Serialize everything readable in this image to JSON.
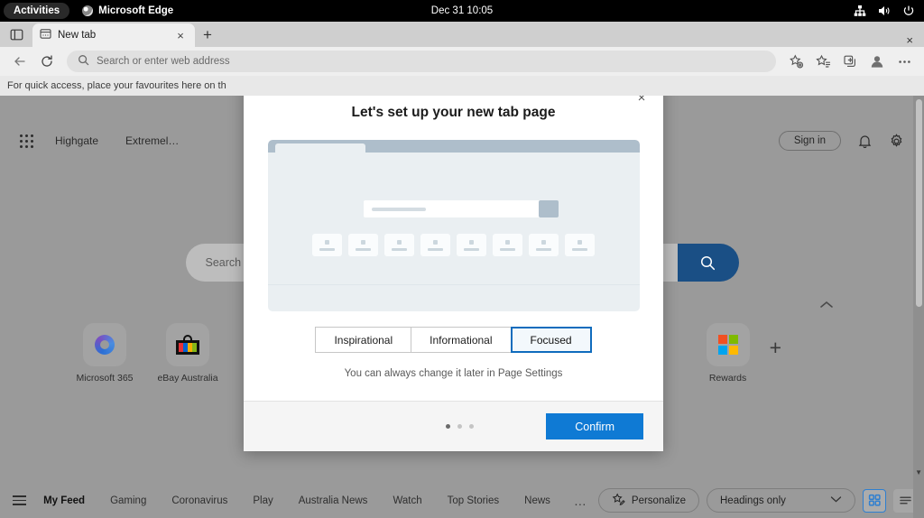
{
  "os_bar": {
    "activities": "Activities",
    "app_name": "Microsoft Edge",
    "clock": "Dec 31  10:05",
    "tray": [
      "network-icon",
      "volume-icon",
      "power-icon"
    ]
  },
  "browser": {
    "tab_title": "New tab",
    "tab_close": "×",
    "new_tab": "+",
    "window_close": "×",
    "sidebar_icon": "sidebar-toggle-icon",
    "back_icon": "back-arrow-icon",
    "reload_icon": "reload-icon",
    "omnibox_placeholder": "Search or enter web address",
    "omnibox_value": "",
    "toolbar_icons": [
      "add-favourite-icon",
      "favourites-icon",
      "collections-icon",
      "profile-icon",
      "settings-more-icon"
    ],
    "favourites_hint": "For quick access, place your favourites here on th"
  },
  "page": {
    "app_grid_icon": "app-grid-icon",
    "links": [
      "Highgate",
      "Extremel…"
    ],
    "sign_in": "Sign in",
    "notifications_icon": "bell-icon",
    "settings_icon": "gear-icon",
    "search_placeholder": "Search th",
    "search_button_icon": "search-icon",
    "collapse_icon": "chevron-up-icon",
    "shortcuts": [
      {
        "label": "Microsoft 365",
        "icon": "microsoft-365-icon"
      },
      {
        "label": "eBay Australia",
        "icon": "ebay-icon"
      },
      {
        "label": "Rewards",
        "icon": "microsoft-rewards-icon"
      }
    ],
    "add_shortcut": "+"
  },
  "feedbar": {
    "menu_icon": "hamburger-icon",
    "items": [
      "My Feed",
      "Gaming",
      "Coronavirus",
      "Play",
      "Australia News",
      "Watch",
      "Top Stories",
      "News"
    ],
    "active_item": "My Feed",
    "more": "…",
    "personalize": "Personalize",
    "personalize_icon": "star-pencil-icon",
    "display_mode": "Headings only",
    "chevron_icon": "chevron-down-icon",
    "grid_view_icon": "grid-view-icon",
    "list_view_icon": "list-view-icon"
  },
  "modal": {
    "close_label": "×",
    "title": "Let's set up your new tab page",
    "layouts": [
      "Inspirational",
      "Informational",
      "Focused"
    ],
    "selected_layout": "Focused",
    "note": "You can always change it later in Page Settings",
    "confirm": "Confirm",
    "page_dots": 3,
    "active_dot": 1
  },
  "colors": {
    "accent_blue": "#0f7ad4",
    "selected_border": "#0f6cbd",
    "search_button": "#1a4f85",
    "preview_bg": "#eaeff2",
    "preview_chrome": "#aebecb"
  }
}
